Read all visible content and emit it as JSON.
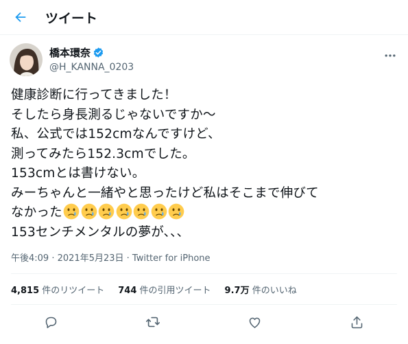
{
  "header": {
    "title": "ツイート"
  },
  "author": {
    "display_name": "橋本環奈",
    "handle": "@H_KANNA_0203"
  },
  "tweet": {
    "lines": [
      "健康診断に行ってきました！",
      "そしたら身長測るじゃないですか〜",
      "私、公式では152cmなんですけど、",
      "測ってみたら152.3cmでした。",
      "153cmとは書けない。",
      "みーちゃんと一緒やと思ったけど私はそこまで伸びて",
      "なかった",
      "153センチメンタルの夢が、、、"
    ],
    "emoji_count": 7
  },
  "meta": {
    "time": "午後4:09",
    "sep": " · ",
    "date": "2021年5月23日",
    "source": "Twitter for iPhone"
  },
  "stats": {
    "retweets": {
      "count": "4,815",
      "label": " 件のリツイート"
    },
    "quotes": {
      "count": "744",
      "label": " 件の引用ツイート"
    },
    "likes": {
      "count": "9.7万",
      "label": " 件のいいね"
    }
  },
  "icons": [
    "back-arrow-icon",
    "verified-badge-icon",
    "more-icon",
    "reply-icon",
    "retweet-icon",
    "like-icon",
    "share-icon",
    "crying-face-icon"
  ],
  "colors": {
    "accent": "#1d9bf0",
    "text": "#0f1419",
    "secondary": "#536471",
    "border": "#eff3f4",
    "emoji": "#ffcc4d"
  }
}
